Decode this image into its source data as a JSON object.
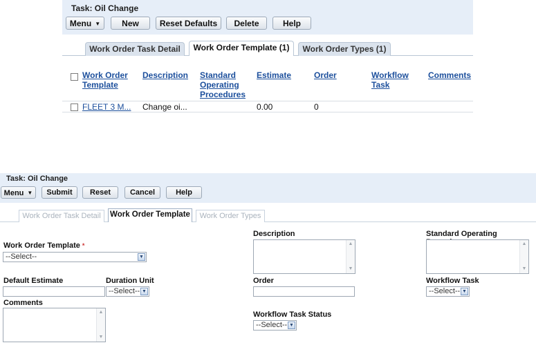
{
  "top_panel": {
    "title": "Task: Oil Change",
    "toolbar": {
      "menu_label": "Menu",
      "new_label": "New",
      "reset_defaults_label": "Reset Defaults",
      "delete_label": "Delete",
      "help_label": "Help"
    },
    "tabs": [
      {
        "label": "Work Order Task Detail",
        "active": false
      },
      {
        "label": "Work Order Template (1)",
        "active": true
      },
      {
        "label": "Work Order Types (1)",
        "active": false
      }
    ],
    "table": {
      "columns": {
        "work_order_template": "Work Order Template",
        "description": "Description",
        "sop": "Standard Operating Procedures",
        "estimate": "Estimate",
        "order": "Order",
        "workflow_task": "Workflow Task",
        "comments": "Comments"
      },
      "rows": [
        {
          "work_order_template": "FLEET 3 M...",
          "description": "Change oi...",
          "sop": "",
          "estimate": "0.00",
          "order": "0",
          "workflow_task": "",
          "comments": ""
        }
      ]
    }
  },
  "bottom_panel": {
    "title": "Task: Oil Change",
    "toolbar": {
      "menu_label": "Menu",
      "submit_label": "Submit",
      "reset_label": "Reset",
      "cancel_label": "Cancel",
      "help_label": "Help"
    },
    "tabs": [
      {
        "label": "Work Order Task Detail",
        "state": "disabled"
      },
      {
        "label": "Work Order Template",
        "state": "active"
      },
      {
        "label": "Work Order Types",
        "state": "disabled"
      }
    ],
    "form": {
      "work_order_template": {
        "label": "Work Order Template",
        "required_marker": "*",
        "value": "--Select--"
      },
      "default_estimate": {
        "label": "Default Estimate",
        "value": ""
      },
      "duration_unit": {
        "label": "Duration Unit",
        "value": "--Select--"
      },
      "comments": {
        "label": "Comments",
        "value": ""
      },
      "description": {
        "label": "Description",
        "value": ""
      },
      "order": {
        "label": "Order",
        "value": ""
      },
      "workflow_task_status": {
        "label": "Workflow Task Status",
        "value": "--Select--"
      },
      "sop": {
        "label": "Standard Operating Procedures",
        "value": ""
      },
      "workflow_task": {
        "label": "Workflow Task",
        "value": "--Select--"
      }
    }
  },
  "icons": {
    "menu_caret": "caret-down-icon",
    "select_arrow": "chevron-down-icon",
    "scroll_up": "scroll-up-icon",
    "scroll_down": "scroll-down-icon"
  },
  "colors": {
    "toolbar_bg": "#e6eef8",
    "link": "#1c4f9c",
    "required": "#cc3333"
  }
}
